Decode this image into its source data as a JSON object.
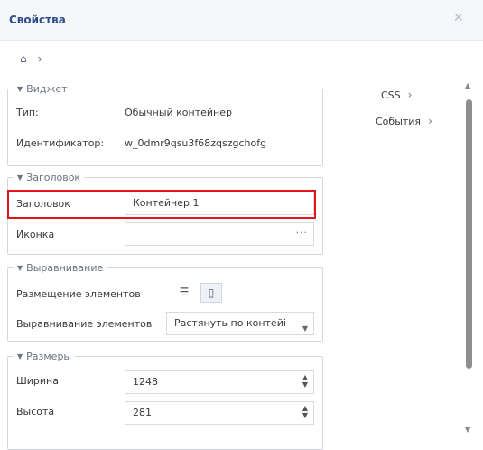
{
  "header": {
    "title": "Свойства",
    "close_icon": "close-icon"
  },
  "breadcrumb": {
    "home_icon": "home-icon",
    "sep": "›"
  },
  "widget": {
    "legend": "Виджет",
    "type_label": "Тип:",
    "type_value": "Обычный контейнер",
    "id_label": "Идентификатор:",
    "id_value": "w_0dmr9qsu3f68zqszgchofg"
  },
  "title_group": {
    "legend": "Заголовок",
    "title_label": "Заголовок",
    "title_value": "Контейнер 1",
    "icon_label": "Иконка",
    "icon_value": "",
    "more": "···"
  },
  "align_group": {
    "legend": "Выравнивание",
    "placement_label": "Размещение элементов",
    "align_label": "Выравнивание элементов",
    "align_value": "Растянуть по контейі"
  },
  "size_group": {
    "legend": "Размеры",
    "width_label": "Ширина",
    "width_value": "1248",
    "height_label": "Высота",
    "height_value": "281"
  },
  "side": {
    "css": "CSS",
    "events": "События"
  }
}
